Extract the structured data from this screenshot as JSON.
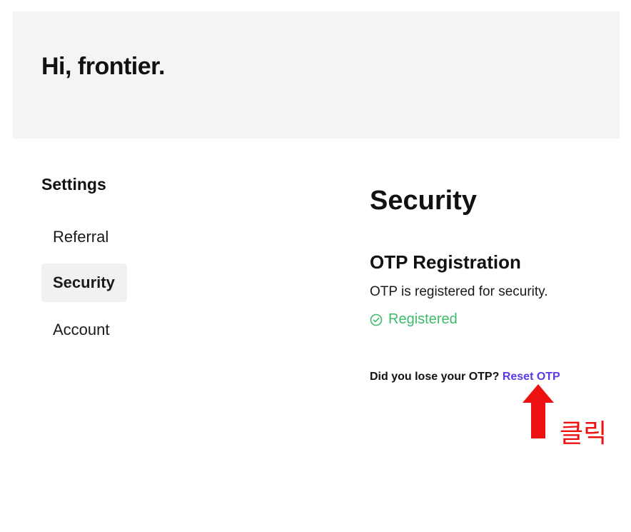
{
  "header": {
    "greeting": "Hi, frontier."
  },
  "sidebar": {
    "title": "Settings",
    "items": [
      {
        "label": "Referral",
        "active": false
      },
      {
        "label": "Security",
        "active": true
      },
      {
        "label": "Account",
        "active": false
      }
    ]
  },
  "main": {
    "title": "Security",
    "otp": {
      "title": "OTP Registration",
      "description": "OTP is registered for security.",
      "status_label": "Registered",
      "status_icon": "check-circle-icon",
      "lost_prompt": "Did you lose your OTP?",
      "reset_link": "Reset OTP"
    }
  },
  "annotation": {
    "click_label": "클릭",
    "arrow_icon": "up-arrow-icon",
    "color": "#ee1111"
  },
  "colors": {
    "header_bg": "#f4f4f4",
    "active_item_bg": "#f1f1f1",
    "status_green": "#3dbb6a",
    "link_purple": "#5b39e6"
  }
}
